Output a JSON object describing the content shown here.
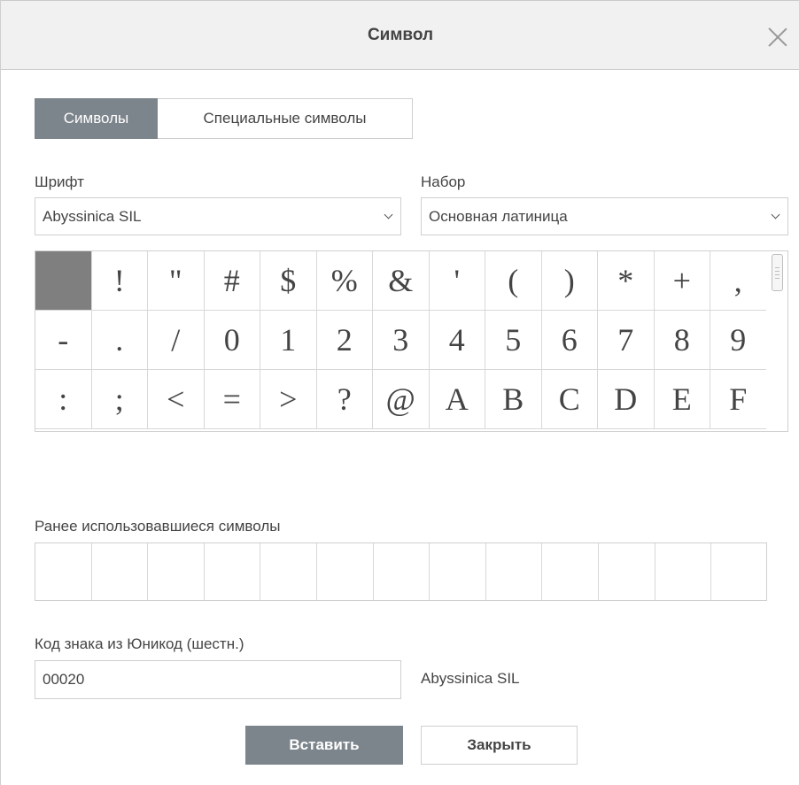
{
  "dialog": {
    "title": "Символ"
  },
  "tabs": [
    {
      "label": "Символы",
      "active": true
    },
    {
      "label": "Специальные символы",
      "active": false
    }
  ],
  "font": {
    "label": "Шрифт",
    "selected": "Abyssinica SIL"
  },
  "subset": {
    "label": "Набор",
    "selected": "Основная латиница"
  },
  "symbols": {
    "rows": [
      [
        " ",
        "!",
        "\"",
        "#",
        "$",
        "%",
        "&",
        "'",
        "(",
        ")",
        "*",
        "+",
        ","
      ],
      [
        "-",
        ".",
        "/",
        "0",
        "1",
        "2",
        "3",
        "4",
        "5",
        "6",
        "7",
        "8",
        "9"
      ],
      [
        ":",
        ";",
        "<",
        "=",
        ">",
        "?",
        "@",
        "A",
        "B",
        "C",
        "D",
        "E",
        "F"
      ]
    ],
    "selected_index": 0
  },
  "recent": {
    "label": "Ранее использовавшиеся символы",
    "items": [
      "",
      "",
      "",
      "",
      "",
      "",
      "",
      "",
      "",
      "",
      "",
      "",
      ""
    ]
  },
  "unicode": {
    "label": "Код знака из Юникод (шестн.)",
    "value": "00020",
    "font_name": "Abyssinica SIL"
  },
  "buttons": {
    "insert": "Вставить",
    "close": "Закрыть"
  },
  "colors": {
    "accent": "#7d858c",
    "selected_cell": "#7f7f7f",
    "border": "#cfcfcf",
    "titlebar": "#f1f1f1"
  }
}
